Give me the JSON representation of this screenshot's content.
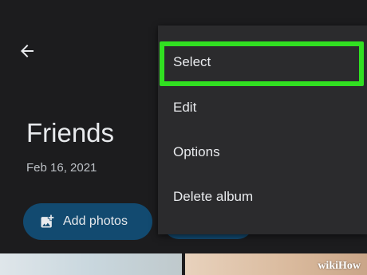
{
  "header": {
    "back_icon": "arrow-left-icon"
  },
  "album": {
    "title": "Friends",
    "date": "Feb 16, 2021"
  },
  "actions": {
    "add_photos_label": "Add photos",
    "add_icon": "add-photo-icon"
  },
  "menu": {
    "items": [
      {
        "label": "Select"
      },
      {
        "label": "Edit"
      },
      {
        "label": "Options"
      },
      {
        "label": "Delete album"
      }
    ],
    "highlighted_item": "Select",
    "highlight_color": "#31e021"
  },
  "watermark": {
    "text": "wikiHow"
  },
  "colors": {
    "background": "#1c1c1e",
    "button": "#124a70",
    "menu": "#2b2b2d"
  }
}
